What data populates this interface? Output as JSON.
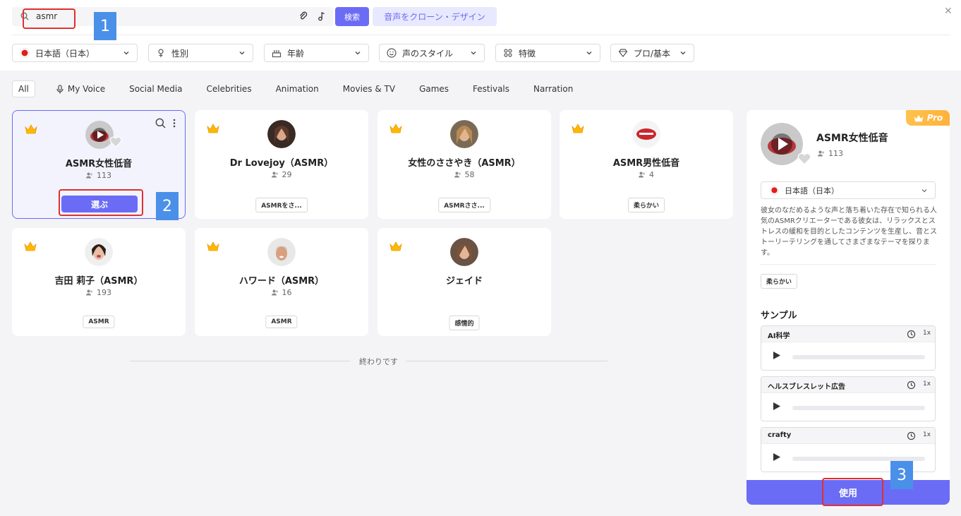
{
  "search": {
    "value": "asmr",
    "button": "検索",
    "clone_button": "音声をクローン・デザイン"
  },
  "filters": [
    {
      "label": "日本語（日本）",
      "icon": "flag-japan-icon"
    },
    {
      "label": "性別",
      "icon": "gender-icon"
    },
    {
      "label": "年齢",
      "icon": "age-icon"
    },
    {
      "label": "声のスタイル",
      "icon": "smile-icon"
    },
    {
      "label": "特徴",
      "icon": "feature-icon"
    },
    {
      "label": "プロ/基本",
      "icon": "diamond-icon"
    }
  ],
  "tabs": [
    "All",
    "My Voice",
    "Social Media",
    "Celebrities",
    "Animation",
    "Movies & TV",
    "Games",
    "Festivals",
    "Narration"
  ],
  "voices": [
    {
      "name": "ASMR女性低音",
      "count": "113",
      "action": "選ぶ"
    },
    {
      "name": "Dr Lovejoy（ASMR）",
      "count": "29",
      "tag": "ASMRをさ..."
    },
    {
      "name": "女性のささやき（ASMR）",
      "count": "58",
      "tag": "ASMRささ..."
    },
    {
      "name": "ASMR男性低音",
      "count": "4",
      "tag": "柔らかい"
    },
    {
      "name": "吉田 莉子（ASMR）",
      "count": "193",
      "tag": "ASMR"
    },
    {
      "name": "ハワード（ASMR）",
      "count": "16",
      "tag": "ASMR"
    },
    {
      "name": "ジェイド",
      "count": "",
      "tag": "感情的"
    }
  ],
  "end_text": "終わりです",
  "detail": {
    "badge": "Pro",
    "name": "ASMR女性低音",
    "count": "113",
    "language": "日本語（日本）",
    "description": "彼女のなだめるような声と落ち着いた存在で知られる人気のASMRクリエーターである彼女は、リラックスとストレスの緩和を目的としたコンテンツを生産し、音とストーリーテリングを通してさまざまなテーマを探ります。",
    "tag": "柔らかい",
    "sample_title": "サンプル",
    "samples": [
      {
        "title": "AI科学",
        "speed": "1x"
      },
      {
        "title": "ヘルスブレスレット広告",
        "speed": "1x"
      },
      {
        "title": "crafty",
        "speed": "1x"
      }
    ],
    "use_button": "使用"
  },
  "annotations": [
    "1",
    "2",
    "3"
  ],
  "colors": {
    "accent": "#6b6cf5",
    "accent_light": "#e8e8fe",
    "pro": "#ffb13b",
    "annotation_box": "#e03030",
    "annotation_num": "#4a90e8"
  }
}
